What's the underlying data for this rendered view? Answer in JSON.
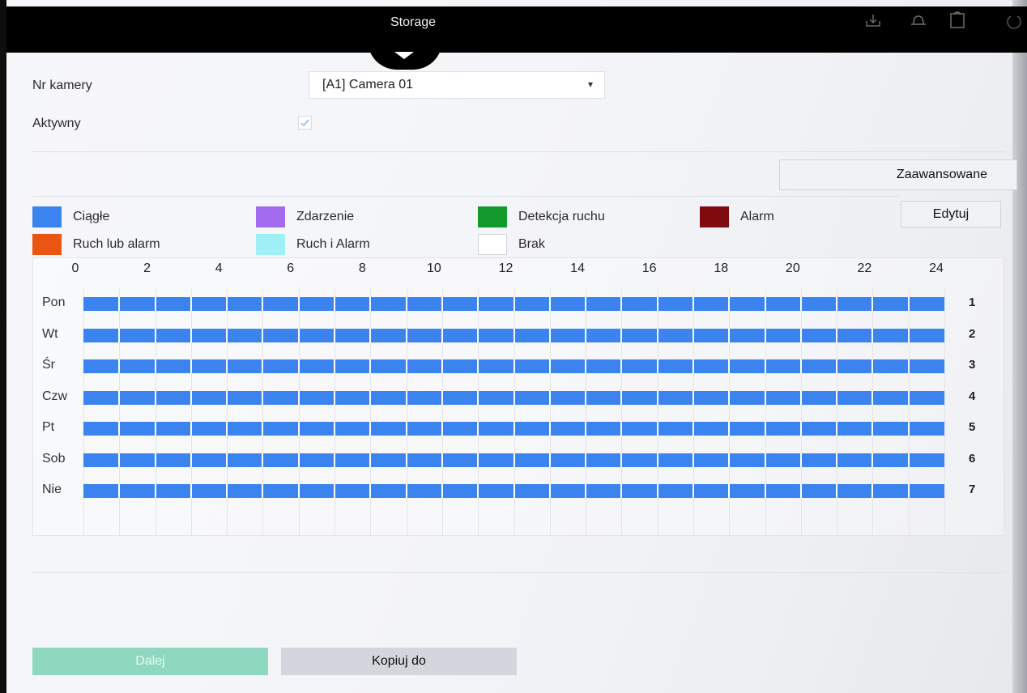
{
  "header": {
    "title": "Storage"
  },
  "camera": {
    "label": "Nr kamery",
    "selected": "[A1] Camera 01"
  },
  "active": {
    "label": "Aktywny",
    "checked": true
  },
  "buttons": {
    "advanced": "Zaawansowane",
    "edit": "Edytuj",
    "next": "Dalej",
    "copy": "Kopiuj do"
  },
  "legend": [
    {
      "label": "Ciągłe",
      "color": "#3b83ee"
    },
    {
      "label": "Zdarzenie",
      "color": "#a36bf0"
    },
    {
      "label": "Detekcja ruchu",
      "color": "#129a2c"
    },
    {
      "label": "Alarm",
      "color": "#7f0b0e"
    },
    {
      "label": "Ruch lub alarm",
      "color": "#ea5514"
    },
    {
      "label": "Ruch i Alarm",
      "color": "#9ff0f4"
    },
    {
      "label": "Brak",
      "color": "#ffffff"
    }
  ],
  "schedule": {
    "hours": [
      "0",
      "2",
      "4",
      "6",
      "8",
      "10",
      "12",
      "14",
      "16",
      "18",
      "20",
      "22",
      "24"
    ],
    "days": [
      {
        "label": "Pon",
        "num": "1",
        "type": "Ciągłe",
        "start": 0,
        "end": 24
      },
      {
        "label": "Wt",
        "num": "2",
        "type": "Ciągłe",
        "start": 0,
        "end": 24
      },
      {
        "label": "Śr",
        "num": "3",
        "type": "Ciągłe",
        "start": 0,
        "end": 24
      },
      {
        "label": "Czw",
        "num": "4",
        "type": "Ciągłe",
        "start": 0,
        "end": 24
      },
      {
        "label": "Pt",
        "num": "5",
        "type": "Ciągłe",
        "start": 0,
        "end": 24
      },
      {
        "label": "Sob",
        "num": "6",
        "type": "Ciągłe",
        "start": 0,
        "end": 24
      },
      {
        "label": "Nie",
        "num": "7",
        "type": "Ciągłe",
        "start": 0,
        "end": 24
      }
    ]
  }
}
